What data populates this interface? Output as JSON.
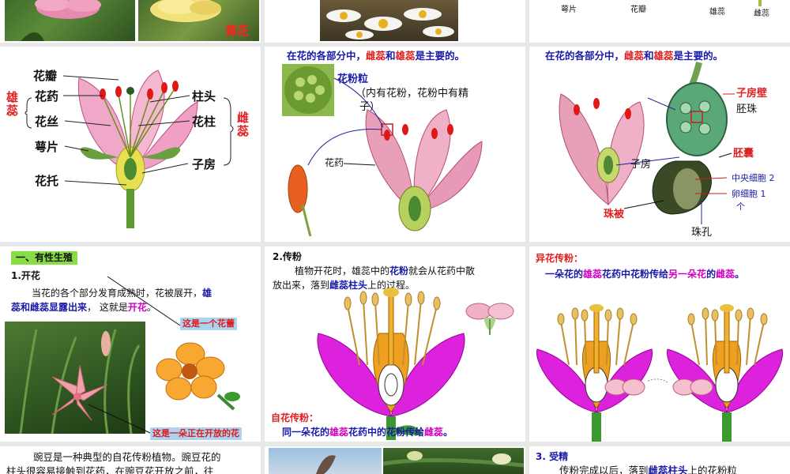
{
  "row1": {
    "photo_caption_yellow": "黄花",
    "labels": {
      "sepal": "萼片",
      "petal": "花瓣",
      "stamen": "雄蕊",
      "pistil": "雌蕊"
    }
  },
  "diagram1": {
    "petal": "花瓣",
    "anther": "花药",
    "filament": "花丝",
    "sepal": "萼片",
    "receptacle": "花托",
    "stigma": "柱头",
    "style": "花柱",
    "ovary": "子房",
    "stamen_group": "雄蕊",
    "pistil_group": "雌蕊"
  },
  "diagram2": {
    "title_prefix": "在花的各部分中，",
    "title_pistil": "雌蕊",
    "title_and": "和",
    "title_stamen": "雄蕊",
    "title_suffix": "是主要的。",
    "pollen_grain": "花粉粒",
    "pollen_desc1": "（内有花粉，花粉中有精",
    "pollen_desc2": "子）",
    "anther": "花药"
  },
  "diagram3": {
    "title_prefix": "在花的各部分中，",
    "title_pistil": "雌蕊",
    "title_and": "和",
    "title_stamen": "雄蕊",
    "title_suffix": "是主要的。",
    "ovary_wall": "子房壁",
    "ovule": "胚珠",
    "ovary": "子房",
    "embryo_sac": "胚囊",
    "central_cell": "中央细胞 2",
    "egg_cell": "卵细胞 1",
    "egg_unit": "个",
    "integument": "珠被",
    "micropyle": "珠孔"
  },
  "section1": {
    "heading": "一、有性生殖",
    "sub": "1.开花",
    "text1": "当花的各个部分发育成熟时，花被展开，",
    "text1_hl": "雄",
    "text2_hl": "蕊和雌蕊显露出来",
    "text2": "，  这就是",
    "text2_end": "开花",
    "text2_dot": "。",
    "bud_label": "这是一个花蕾",
    "open_label": "这是一朵正在开放的花"
  },
  "section2": {
    "sub": "2.传粉",
    "text1a": "植物开花时，雄蕊中的",
    "text1b": "花粉",
    "text1c": "就会从花药中散",
    "text2a": "放出来，落到",
    "text2b": "雌蕊柱头",
    "text2c": "上的过程。",
    "self_title": "自花传粉：",
    "self_a": "同一朵花的",
    "self_b": "雄蕊",
    "self_c": "花药中的花粉传给",
    "self_d": "雌蕊",
    "self_e": "。"
  },
  "section3": {
    "cross_title": "异花传粉：",
    "cross_a": "一朵花的",
    "cross_b": "雄蕊",
    "cross_c": "花药中花粉传给",
    "cross_d": "另一朵花",
    "cross_e": "的",
    "cross_f": "雌蕊",
    "cross_g": "。"
  },
  "row4": {
    "pea_text1": "豌豆是一种典型的自花传粉植物。豌豆花的",
    "pea_text2": "柱头很容易接触到花药，在豌豆花开放之前，往",
    "fert_sub": "3. 受精",
    "fert_text_a": "传粉完成以后，落到",
    "fert_text_b": "雌蕊柱头",
    "fert_text_c": "上的花粉粒"
  }
}
